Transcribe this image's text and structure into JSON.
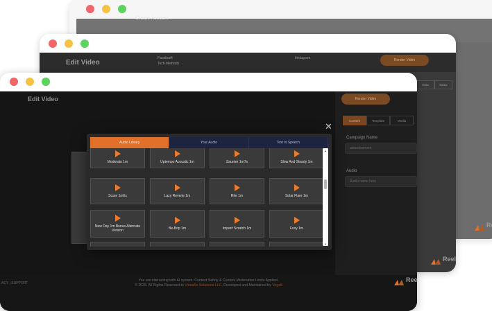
{
  "back_window": {
    "title": "Create Account"
  },
  "middle_window": {
    "title": "Edit Video",
    "field1_label": "Facebook",
    "field1_value": "Tech Methods",
    "field2_label": "Instagram",
    "render_button": "Render Video",
    "tabs": [
      "Video",
      "Media"
    ]
  },
  "front_window": {
    "title": "Edit Video",
    "render_button": "Render Video",
    "side_tabs": [
      "Content",
      "Template",
      "Media"
    ],
    "campaign_label": "Campaign Name",
    "campaign_placeholder": "advertisement",
    "audio_label": "Audio",
    "audio_placeholder": "Audio name here",
    "footer_line1": "You are interacting with AI system. Content Safety & Content Moderation Limits Applied.",
    "footer_line2_pre": "© 2025. All Rights Reserved to ",
    "footer_company": "VineaSx Solutions LLC",
    "footer_line2_mid": ". Developed and Maintained by ",
    "footer_dev": "Vega6",
    "privacy": "ACY | SUPPORT",
    "logo_text": "Reel"
  },
  "modal": {
    "close_glyph": "✕",
    "tabs": [
      "Audio Library",
      "Your Audio",
      "Text to Speech"
    ],
    "active_tab": "Audio Library",
    "tracks": [
      "Moderato 1m",
      "Uptempo Acoustic 1m",
      "Saunter 1m7s",
      "Slow And Steady 1m",
      "Scare 1m6s",
      "Lazy Reverie 1m",
      "Rite 1m",
      "Solar Flare 1m",
      "New Day 1m Bonus Alternate Version",
      "Be-Bop 1m",
      "Impact Scratch 1m",
      "Foxy 1m"
    ],
    "accent": "#e0702a"
  }
}
